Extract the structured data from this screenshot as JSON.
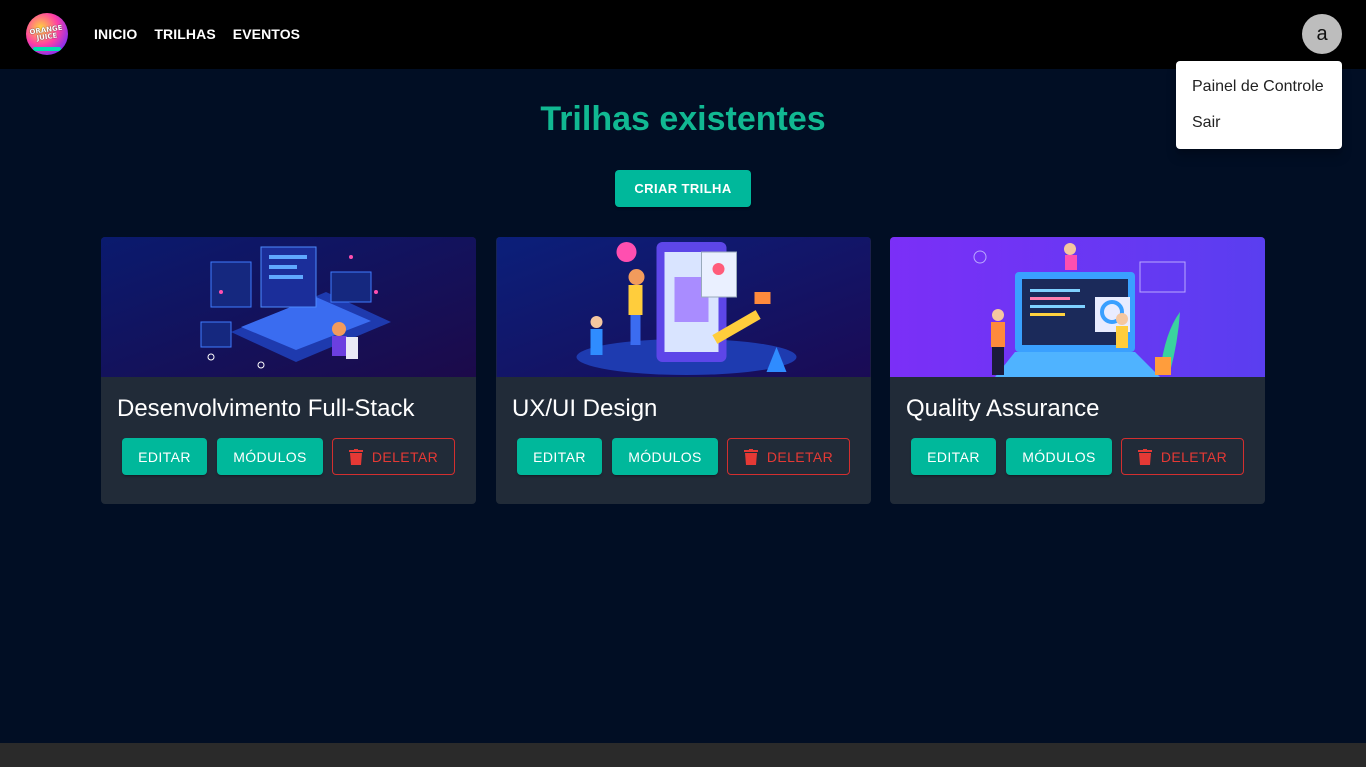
{
  "header": {
    "logo_text": "ORANGE JUICE",
    "nav": [
      "INICIO",
      "TRILHAS",
      "EVENTOS"
    ],
    "avatar_letter": "a"
  },
  "menu": {
    "items": [
      "Painel de Controle",
      "Sair"
    ]
  },
  "main": {
    "title": "Trilhas existentes",
    "create_button": "CRIAR TRILHA"
  },
  "cards": [
    {
      "title": "Desenvolvimento Full-Stack",
      "edit": "EDITAR",
      "modules": "MÓDULOS",
      "delete": "DELETAR"
    },
    {
      "title": "UX/UI Design",
      "edit": "EDITAR",
      "modules": "MÓDULOS",
      "delete": "DELETAR"
    },
    {
      "title": "Quality Assurance",
      "edit": "EDITAR",
      "modules": "MÓDULOS",
      "delete": "DELETAR"
    }
  ],
  "colors": {
    "accent": "#00b89b",
    "title": "#11b892",
    "danger": "#e53935",
    "background": "#010e24",
    "card": "#212b38"
  }
}
